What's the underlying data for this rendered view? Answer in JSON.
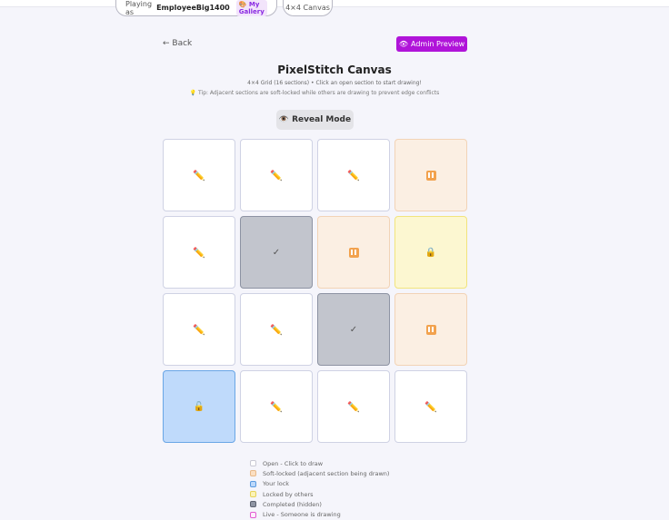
{
  "header": {
    "playing_as_label": "Playing as",
    "username": "EmployeeBig1400",
    "gallery_link": "My Gallery",
    "canvas_badge": "4×4 Canvas"
  },
  "nav": {
    "back_label": "← Back",
    "admin_preview_label": "Admin Preview"
  },
  "page": {
    "title": "PixelStitch Canvas",
    "subtitle": "4×4 Grid (16 sections) • Click an open section to start drawing!",
    "tip": "💡 Tip: Adjacent sections are soft-locked while others are drawing to prevent edge conflicts",
    "reveal_label": "Reveal Mode"
  },
  "grid": {
    "rows": 4,
    "cols": 4,
    "cells": [
      "open",
      "open",
      "open",
      "soft",
      "open",
      "done",
      "soft",
      "others",
      "open",
      "open",
      "done",
      "soft",
      "mine",
      "open",
      "open",
      "open"
    ]
  },
  "icons": {
    "open": "pencil-icon",
    "soft": "pause-icon",
    "done": "check-icon",
    "others": "lock-icon",
    "mine": "unlock-icon"
  },
  "legend": [
    {
      "key": "open",
      "label": "Open - Click to draw",
      "fill": "#ffffff",
      "border": "#c9c9d4"
    },
    {
      "key": "soft",
      "label": "Soft-locked (adjacent section being drawn)",
      "fill": "#fbdfc2",
      "border": "#e8b98a"
    },
    {
      "key": "mine",
      "label": "Your lock",
      "fill": "#bcd8fa",
      "border": "#5b9be0"
    },
    {
      "key": "others",
      "label": "Locked by others",
      "fill": "#fbf3b8",
      "border": "#e7d35a"
    },
    {
      "key": "done",
      "label": "Completed (hidden)",
      "fill": "#8f95a3",
      "border": "#5d6270"
    },
    {
      "key": "live",
      "label": "Live - Someone is drawing",
      "fill": "#fdeefb",
      "border": "#e25bd2"
    }
  ],
  "colors": {
    "accent": "#b014d9",
    "gallery_text": "#8a2be2"
  }
}
